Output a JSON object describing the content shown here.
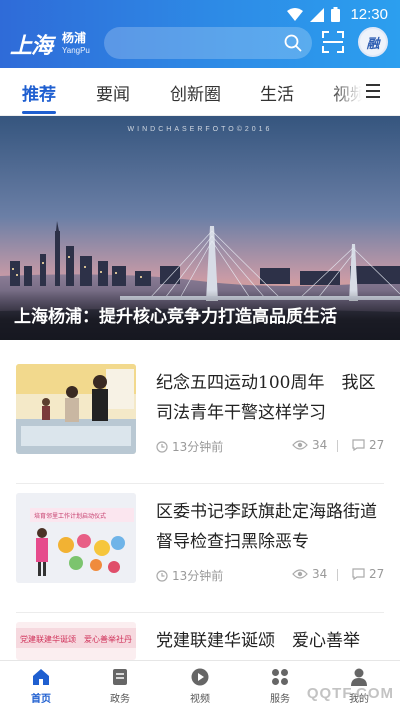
{
  "status_bar": {
    "time": "12:30",
    "icons": [
      "wifi-icon",
      "signal-icon",
      "battery-icon"
    ]
  },
  "header": {
    "logo_big": "上海",
    "logo_small": "杨浦",
    "logo_en": "YangPu",
    "avatar_text": "融",
    "icons": [
      "search-icon",
      "scan-icon"
    ]
  },
  "tabs": [
    {
      "label": "推荐",
      "active": true
    },
    {
      "label": "要闻",
      "active": false
    },
    {
      "label": "创新圈",
      "active": false
    },
    {
      "label": "生活",
      "active": false
    },
    {
      "label": "视频",
      "active": false
    }
  ],
  "banner": {
    "watermark": "WINDCHASERFOTO©2016",
    "caption": "上海杨浦：提升核心竞争力打造高品质生活"
  },
  "news": [
    {
      "title": "纪念五四运动100周年　我区司法青年干警这样学习",
      "time": "13分钟前",
      "views": "34",
      "comments": "27"
    },
    {
      "title": "区委书记李跃旗赴定海路街道督导检查扫黑除恶专",
      "thumb_text": "培育邻里工作计划启动仪式",
      "time": "13分钟前",
      "views": "34",
      "comments": "27"
    },
    {
      "title": "党建联建华诞颂　爱心善举",
      "thumb_text": "党建联建华诞颂　爱心善举社丹",
      "time": "",
      "views": "",
      "comments": ""
    }
  ],
  "bottom_nav": [
    {
      "label": "首页",
      "icon": "home-icon",
      "active": true
    },
    {
      "label": "政务",
      "icon": "document-icon",
      "active": false
    },
    {
      "label": "视频",
      "icon": "play-icon",
      "active": false
    },
    {
      "label": "服务",
      "icon": "grid-icon",
      "active": false
    },
    {
      "label": "我的",
      "icon": "user-icon",
      "active": false
    }
  ],
  "corner_watermark": "QQTF.COM",
  "colors": {
    "accent": "#1f5fd0",
    "header_start": "#2f6bd8",
    "header_end": "#2c9fef"
  }
}
